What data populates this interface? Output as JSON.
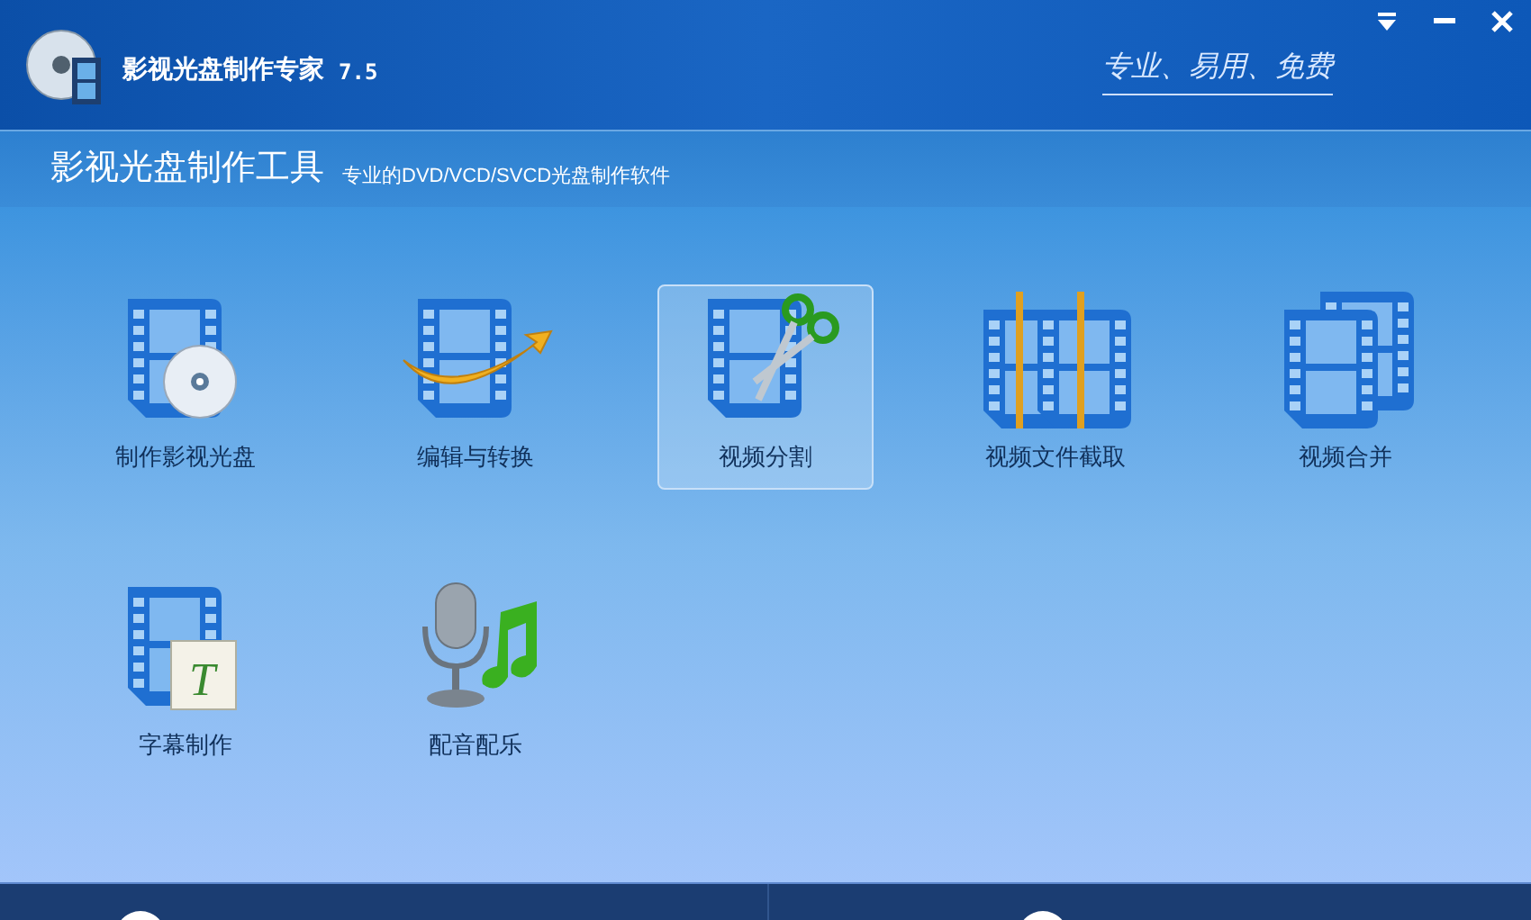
{
  "window": {
    "title": "影视光盘制作专家",
    "version": "7.5",
    "slogan": "专业、易用、免费"
  },
  "header": {
    "title": "影视光盘制作工具",
    "subtitle": "专业的DVD/VCD/SVCD光盘制作软件"
  },
  "tools": [
    {
      "label": "制作影视光盘",
      "kind": "disc",
      "selected": false
    },
    {
      "label": "编辑与转换",
      "kind": "convert",
      "selected": false
    },
    {
      "label": "视频分割",
      "kind": "split",
      "selected": true
    },
    {
      "label": "视频文件截取",
      "kind": "clip",
      "selected": false
    },
    {
      "label": "视频合并",
      "kind": "merge",
      "selected": false
    },
    {
      "label": "字幕制作",
      "kind": "subtitle",
      "selected": false,
      "icon_letter": "T"
    },
    {
      "label": "配音配乐",
      "kind": "audio",
      "selected": false
    }
  ]
}
